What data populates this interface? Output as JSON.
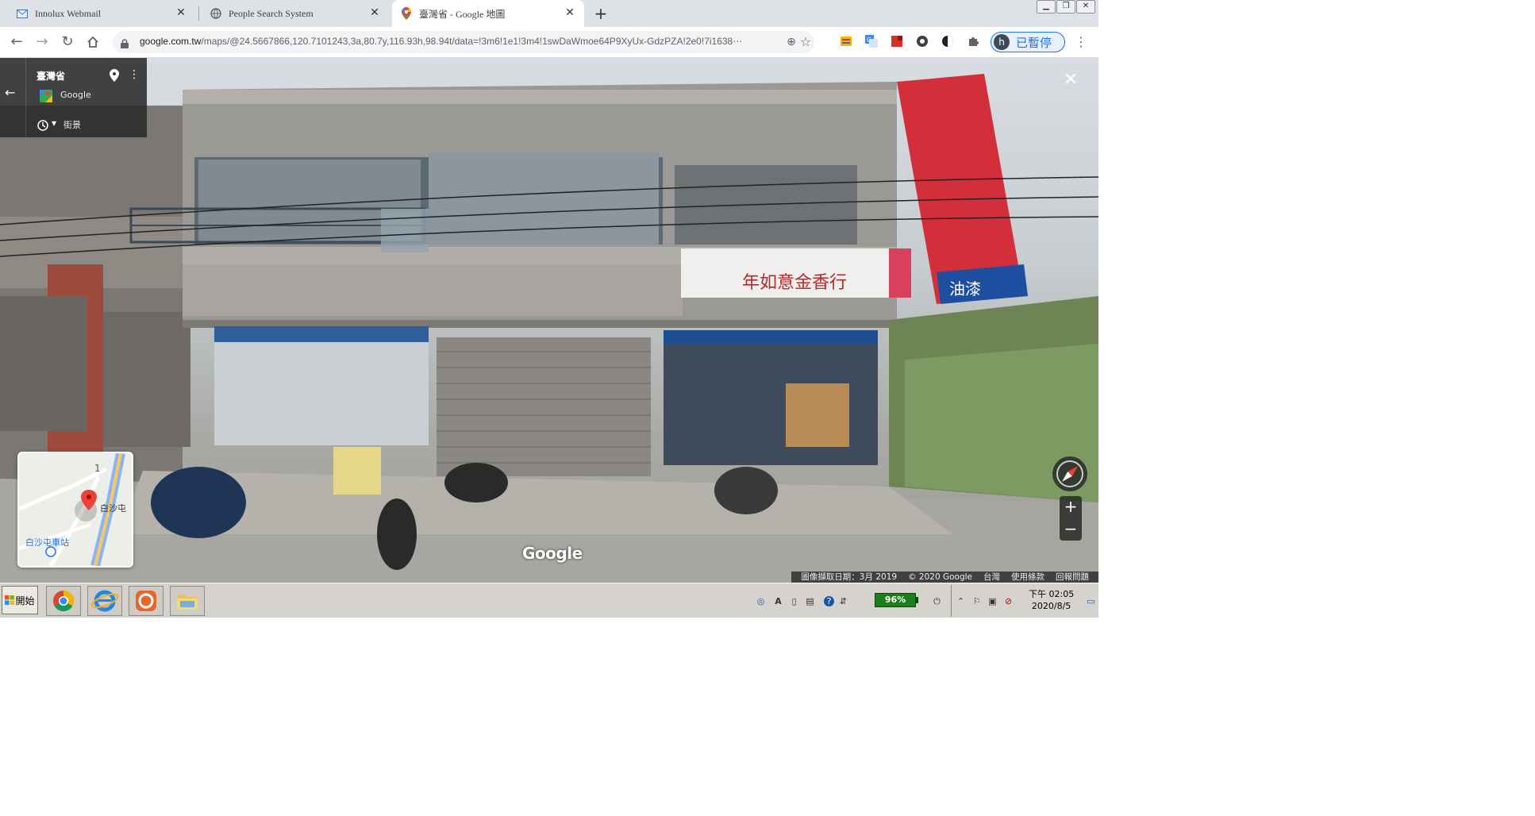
{
  "browser": {
    "tabs": [
      {
        "title": "Innolux Webmail",
        "icon": "mail-icon",
        "active": false
      },
      {
        "title": "People Search System",
        "icon": "globe-icon",
        "active": false
      },
      {
        "title": "臺灣省 - Google 地圖",
        "icon": "maps-pin-icon",
        "active": true
      }
    ],
    "new_tab": "+",
    "url_host": "google.com.tw",
    "url_rest": "/maps/@24.5667866,120.7101243,3a,80.7y,116.93h,98.94t/data=!3m6!1e1!3m4!1swDaWmoe64P9XyUx-GdzPZA!2e0!7i1638⋯",
    "profile_initial": "h",
    "profile_label": "已暫停"
  },
  "streetview": {
    "place_title": "臺灣省",
    "source": "Google",
    "mode_label": "街景",
    "minimap": {
      "road_number": "1",
      "poi_label": "白沙屯",
      "station_label": "白沙屯車站"
    },
    "wordmark": "Google",
    "attribution": [
      "圖像擷取日期：3月 2019",
      "© 2020 Google",
      "台灣",
      "使用條款",
      "回報問題"
    ],
    "zoom_in": "+",
    "zoom_out": "−"
  },
  "taskbar": {
    "start_label": "開始",
    "quicklaunch": [
      "chrome-icon",
      "internet-explorer-icon",
      "app-icon",
      "folder-icon"
    ],
    "battery": "96%",
    "clock_time": "下午 02:05",
    "clock_date": "2020/8/5"
  }
}
